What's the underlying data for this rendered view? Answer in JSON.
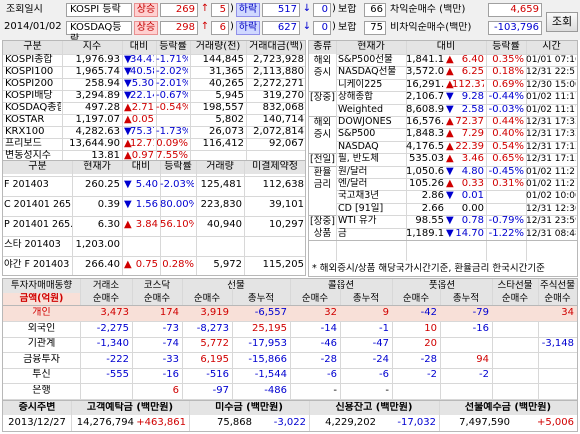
{
  "header": {
    "label_time": "조회일시",
    "date": "2014/01/02",
    "search_btn": "조회",
    "rows": [
      {
        "market": "KOSPI 등락",
        "up_label": "상승",
        "up_count": "269",
        "up_limit": "5",
        "down_label": "하락",
        "down_count": "517",
        "down_limit": "0",
        "flat_label": "보합",
        "flat_count": "66",
        "net_label": "차익순매수 (백만)",
        "net_value": "4,659"
      },
      {
        "market": "KOSDAQ등락",
        "up_label": "상승",
        "up_count": "298",
        "up_limit": "6",
        "down_label": "하락",
        "down_count": "627",
        "down_limit": "0",
        "flat_label": "보합",
        "flat_count": "75",
        "net_label": "비차익순매수(백만)",
        "net_value": "-103,796"
      }
    ]
  },
  "index": {
    "headers": [
      "구분",
      "지수",
      "대비",
      "등락률",
      "거래량(천)",
      "거래대금(백)"
    ],
    "rows": [
      {
        "name": "KOSPI종합",
        "value": "1,976.93",
        "arrow": "▼",
        "chg": "34.41",
        "rate": "-1.71%",
        "vol": "144,845",
        "amt": "2,723,928",
        "dir": "down"
      },
      {
        "name": "KOSPI100",
        "value": "1,965.74",
        "arrow": "▼",
        "chg": "40.58",
        "rate": "-2.02%",
        "vol": "31,365",
        "amt": "2,113,880",
        "dir": "down"
      },
      {
        "name": "KOSPI200",
        "value": "258.94",
        "arrow": "▼",
        "chg": "5.30",
        "rate": "-2.01%",
        "vol": "40,265",
        "amt": "2,272,271",
        "dir": "down"
      },
      {
        "name": "KOSPI배당",
        "value": "3,294.89",
        "arrow": "▼",
        "chg": "22.14",
        "rate": "-0.67%",
        "vol": "5,945",
        "amt": "319,270",
        "dir": "down"
      },
      {
        "name": "KOSDAQ종합",
        "value": "497.28",
        "arrow": "▲",
        "chg": "2.71",
        "rate": "-0.54%",
        "vol": "198,557",
        "amt": "832,068",
        "dir": "up"
      },
      {
        "name": "KOSTAR",
        "value": "1,197.07",
        "arrow": "▲",
        "chg": "0.05",
        "rate": "",
        "vol": "5,802",
        "amt": "140,714",
        "dir": "up"
      },
      {
        "name": "KRX100",
        "value": "4,282.63",
        "arrow": "▼",
        "chg": "75.37",
        "rate": "-1.73%",
        "vol": "26,073",
        "amt": "2,072,814",
        "dir": "down"
      },
      {
        "name": "프리보드",
        "value": "13,644.90",
        "arrow": "▲",
        "chg": "12.71",
        "rate": "0.09%",
        "vol": "116,412",
        "amt": "92,067",
        "dir": "up"
      },
      {
        "name": "변동성지수",
        "value": "13.81",
        "arrow": "▲",
        "chg": "0.97",
        "rate": "7.55%",
        "vol": "",
        "amt": "",
        "dir": "up"
      }
    ]
  },
  "futures": {
    "headers": [
      "구분",
      "현재가",
      "대비",
      "등락률",
      "거래량",
      "미결제약정"
    ],
    "rows": [
      {
        "name": "F 201403",
        "value": "260.25",
        "arrow": "▼",
        "chg": "5.40",
        "rate": "-2.03%",
        "vol": "125,481",
        "oi": "112,638",
        "dir": "down"
      },
      {
        "name": "C 201401 265.0",
        "value": "0.39",
        "arrow": "▼",
        "chg": "1.56",
        "rate": "80.00%",
        "vol": "223,830",
        "oi": "39,101",
        "dir": "down"
      },
      {
        "name": "P 201401 265.0",
        "value": "6.30",
        "arrow": "▲",
        "chg": "3.84",
        "rate": "56.10%",
        "vol": "40,940",
        "oi": "10,297",
        "dir": "up"
      },
      {
        "name": "스타 201403",
        "value": "1,203.00",
        "arrow": "",
        "chg": "",
        "rate": "",
        "vol": "",
        "oi": "",
        "dir": "up"
      },
      {
        "name": "야간 F 201403",
        "value": "266.40",
        "arrow": "▲",
        "chg": "0.75",
        "rate": "0.28%",
        "vol": "5,972",
        "oi": "115,205",
        "dir": "up"
      }
    ]
  },
  "world": {
    "headers": [
      "종류",
      "현재가",
      "대비",
      "등락률",
      "시간"
    ],
    "groups": [
      {
        "label": "해외\n증시",
        "rows": [
          {
            "name": "S&P500선물",
            "value": "1,841.10",
            "arrow": "▲",
            "chg": "6.40",
            "rate": "0.35%",
            "time": "01/01 07:16",
            "dir": "up"
          },
          {
            "name": "NASDAQ선물",
            "value": "3,572.00",
            "arrow": "▲",
            "chg": "6.25",
            "rate": "0.18%",
            "time": "12/31 22:51",
            "dir": "up"
          },
          {
            "name": "니케이225",
            "value": "16,291.31",
            "arrow": "▲",
            "chg": "112.37",
            "rate": "0.69%",
            "time": "12/30 15:00",
            "dir": "up"
          }
        ]
      },
      {
        "label": "[장중]",
        "rows": [
          {
            "name": "상해종합",
            "value": "2,106.70",
            "arrow": "▼",
            "chg": "9.28",
            "rate": "-0.44%",
            "time": "01/02 11:17",
            "dir": "down"
          },
          {
            "name": "Weighted",
            "value": "8,608.93",
            "arrow": "▼",
            "chg": "2.58",
            "rate": "-0.03%",
            "time": "01/02 11:17",
            "dir": "down"
          }
        ]
      },
      {
        "label": "해외\n증시",
        "rows": [
          {
            "name": "DOWJONES",
            "value": "16,576.66",
            "arrow": "▲",
            "chg": "72.37",
            "rate": "0.44%",
            "time": "12/31 17:33",
            "dir": "up"
          },
          {
            "name": "S&P500",
            "value": "1,848.36",
            "arrow": "▲",
            "chg": "7.29",
            "rate": "0.40%",
            "time": "12/31 17:33",
            "dir": "up"
          },
          {
            "name": "NASDAQ",
            "value": "4,176.59",
            "arrow": "▲",
            "chg": "22.39",
            "rate": "0.54%",
            "time": "12/31 17:15",
            "dir": "up"
          }
        ]
      },
      {
        "label": "[전일]",
        "rows": [
          {
            "name": "필, 반도체",
            "value": "535.03",
            "arrow": "▲",
            "chg": "3.46",
            "rate": "0.65%",
            "time": "12/31 17:15",
            "dir": "up"
          }
        ]
      },
      {
        "label": "환율\n금리",
        "rows": [
          {
            "name": "원/달러",
            "value": "1,050.60",
            "arrow": "▼",
            "chg": "4.80",
            "rate": "-0.45%",
            "time": "01/02 11:21",
            "dir": "down"
          },
          {
            "name": "엔/달러",
            "value": "105.26",
            "arrow": "▲",
            "chg": "0.33",
            "rate": "0.31%",
            "time": "01/02 11:21",
            "dir": "up"
          },
          {
            "name": "국고채3년",
            "value": "2.86",
            "arrow": "▼",
            "chg": "0.01",
            "rate": "",
            "time": "01/02 10:00",
            "dir": "down"
          },
          {
            "name": "CD [91일]",
            "value": "2.66",
            "arrow": "",
            "chg": "0.00",
            "rate": "",
            "time": "12/31 12:30",
            "dir": "flat"
          }
        ]
      },
      {
        "label": "[장중]\n상품",
        "rows": [
          {
            "name": "WTI 유가",
            "value": "98.55",
            "arrow": "▼",
            "chg": "0.78",
            "rate": "-0.79%",
            "time": "12/31 23:59",
            "dir": "down"
          },
          {
            "name": "금",
            "value": "1,189.10",
            "arrow": "▼",
            "chg": "14.70",
            "rate": "-1.22%",
            "time": "12/31 08:48",
            "dir": "down"
          }
        ]
      }
    ],
    "note": "* 해외증시/상품 해당국가시간기준, 환율금리 한국시간기준"
  },
  "investor": {
    "top_headers": [
      "투자자매매동향",
      "거래소",
      "코스닥",
      "선물",
      "콜옵션",
      "풋옵션",
      "스타선물",
      "주식선물"
    ],
    "sub_headers": [
      "금액(억원)",
      "순매수",
      "순매수",
      "순매수",
      "총누적",
      "순매수",
      "총누적",
      "순매수",
      "총누적",
      "순매수",
      "순매수"
    ],
    "rows": [
      {
        "name": "개인",
        "v": [
          "3,473",
          "174",
          "3,919",
          "-6,557",
          "32",
          "9",
          "-42",
          "-79",
          "34"
        ],
        "sel": true
      },
      {
        "name": "외국인",
        "v": [
          "-2,275",
          "-73",
          "-8,273",
          "25,195",
          "-14",
          "-1",
          "10",
          "-16",
          ""
        ],
        "sel": false
      },
      {
        "name": "기관계",
        "v": [
          "-1,340",
          "-74",
          "5,772",
          "-17,953",
          "-46",
          "-47",
          "20",
          "",
          "-3,148"
        ],
        "sel": false
      },
      {
        "name": "금융투자",
        "v": [
          "-222",
          "-33",
          "6,195",
          "-15,866",
          "-28",
          "-24",
          "-28",
          "94",
          ""
        ],
        "sel": false
      },
      {
        "name": "투신",
        "v": [
          "-555",
          "-16",
          "-516",
          "-1,544",
          "-6",
          "-6",
          "-2",
          "-2",
          ""
        ],
        "sel": false
      },
      {
        "name": "은행",
        "v": [
          "",
          "6",
          "-97",
          "-486",
          "-",
          "-",
          "",
          "",
          ""
        ],
        "sel": false
      }
    ]
  },
  "footer": {
    "headers": [
      "증시주변",
      "고객예탁금 (백만원)",
      "미수금 (백만원)",
      "신용잔고 (백만원)",
      "선물예수금 (백만원)"
    ],
    "date": "2013/12/27",
    "deposit": "14,276,794",
    "deposit_chg": "+463,861",
    "unpaid": "75,868",
    "unpaid_chg": "-3,022",
    "credit": "4,229,202",
    "credit_chg": "-17,032",
    "fut_deposit": "7,497,590",
    "fut_deposit_chg": "+5,006"
  },
  "colors": {
    "up": "#d00000",
    "down": "#0000d0",
    "header_bg": "#e4e4e4",
    "selected_row": "#f8e0d8"
  }
}
